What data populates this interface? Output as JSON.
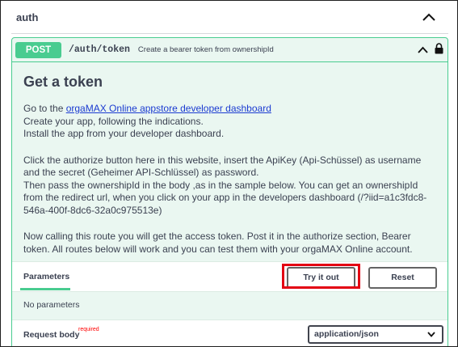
{
  "section": {
    "title": "auth"
  },
  "operation": {
    "method": "POST",
    "path": "/auth/token",
    "summary": "Create a bearer token from ownershipId",
    "color": "#49cc90"
  },
  "description": {
    "heading": "Get a token",
    "p1_prefix": "Go to the ",
    "p1_link": "orgaMAX Online appstore developer dashboard",
    "p1_line2": "Create your app, following the indications.",
    "p1_line3": "Install the app from your developer dashboard.",
    "p2": "Click the authorize button here in this website, insert the ApiKey (Api-Schüssel) as username and the secret (Geheimer API-Schlüssel) as password.",
    "p2_line2": "Then pass the ownershipId in the body ,as in the sample below. You can get an ownershipId from the redirect url, when you click on your app in the developers dashboard (/?iid=a1c3fdc8-546a-400f-8dc6-32a0c975513e)",
    "p3": "Now calling this route you will get the access token. Post it in the authorize section, Bearer token. All routes below will work and you can test them with your orgaMAX Online account."
  },
  "parameters": {
    "tab_label": "Parameters",
    "try_button": "Try it out",
    "reset_button": "Reset",
    "empty_text": "No parameters",
    "highlight_color": "#e30013"
  },
  "request_body": {
    "label": "Request body",
    "required_flag": "required",
    "content_type": "application/json"
  }
}
